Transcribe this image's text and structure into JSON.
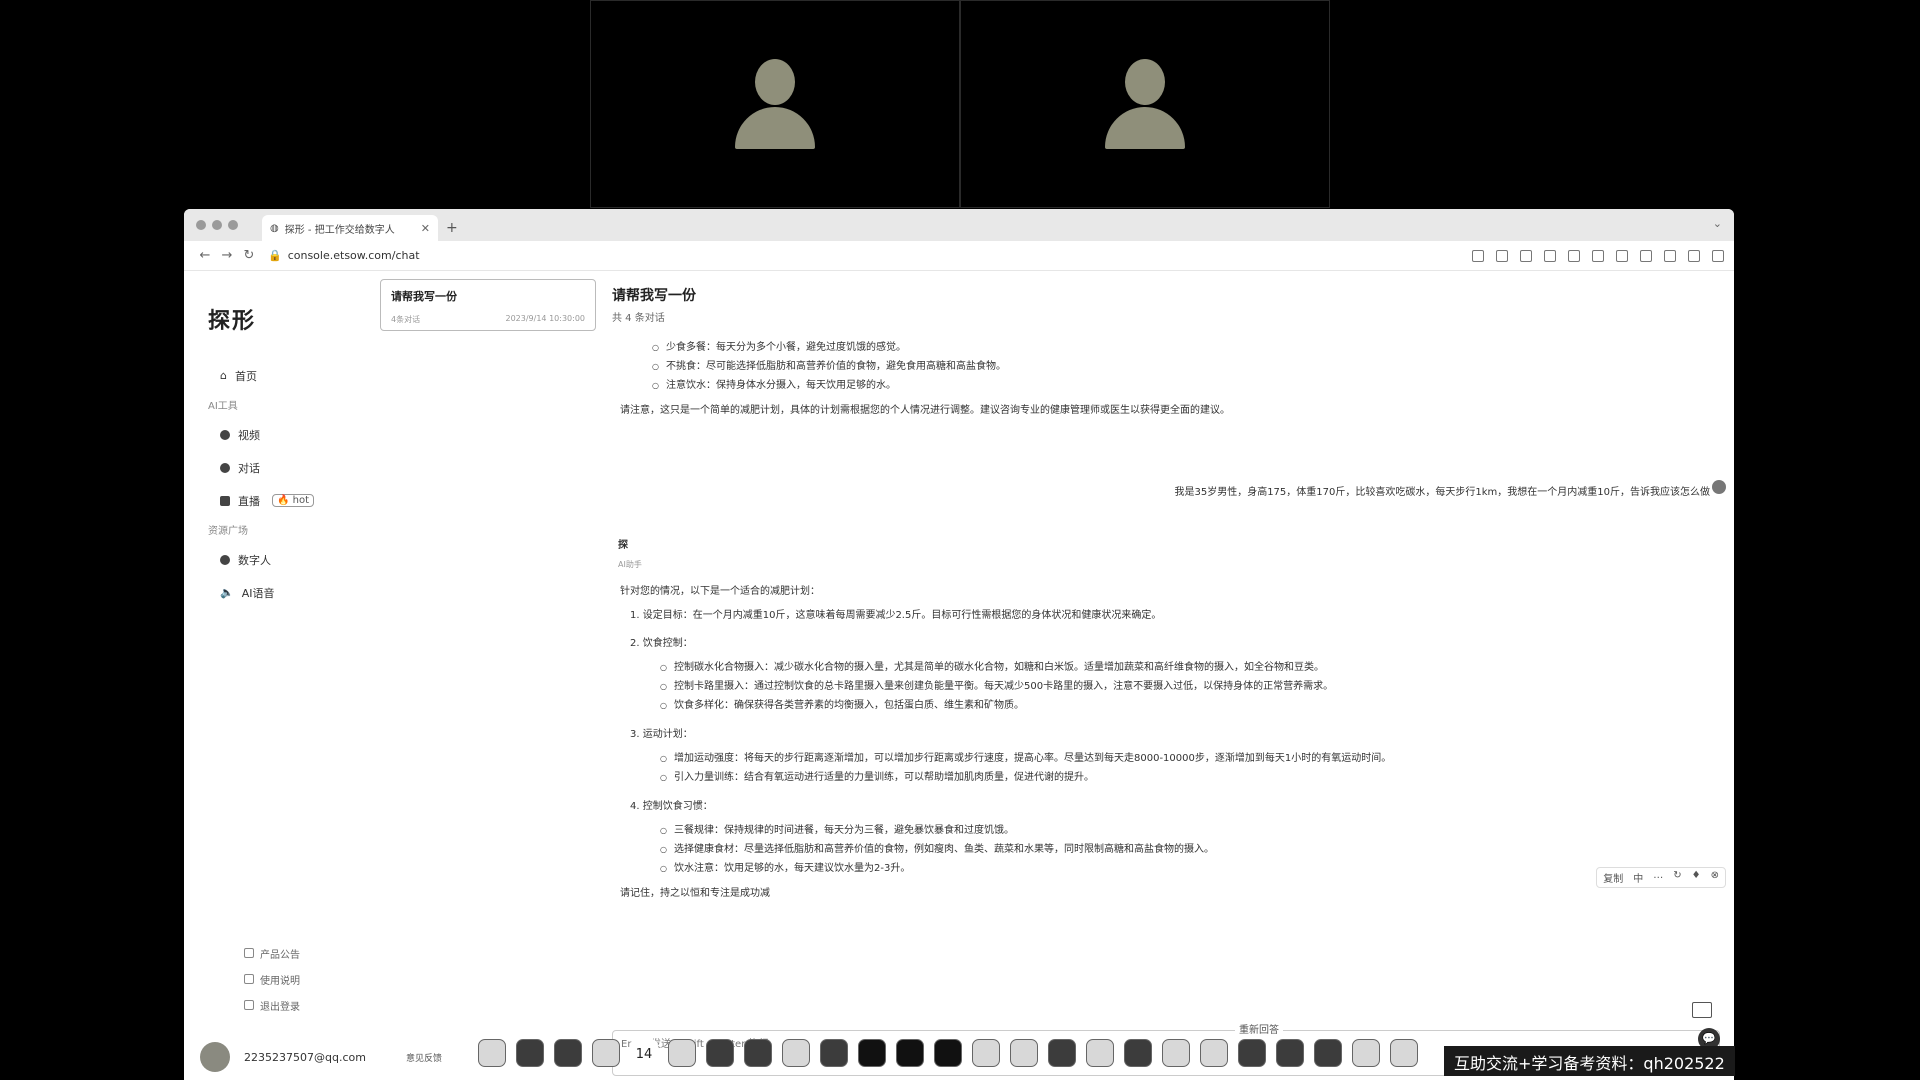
{
  "tab": {
    "title": "探形 - 把工作交给数字人"
  },
  "address": {
    "url": "console.etsow.com/chat"
  },
  "sidebar": {
    "logo": "探形",
    "home": "首页",
    "sections": [
      {
        "title": "AI工具",
        "items": [
          {
            "label": "视频",
            "badge": ""
          },
          {
            "label": "对话",
            "badge": ""
          },
          {
            "label": "直播",
            "badge": "🔥 hot"
          }
        ]
      },
      {
        "title": "资源广场",
        "items": [
          {
            "label": "数字人",
            "badge": ""
          },
          {
            "label": "AI语音",
            "badge": ""
          }
        ]
      }
    ],
    "footer": [
      "产品公告",
      "使用说明",
      "退出登录"
    ],
    "user_email": "2235237507@qq.com",
    "feedback": "意见反馈"
  },
  "conversations": [
    {
      "title": "请帮我写一份",
      "count": "4条对话",
      "time": "2023/9/14 10:30:00"
    }
  ],
  "chat": {
    "title": "请帮我写一份",
    "subtitle": "共 4 条对话",
    "prev_bullets": [
      "少食多餐：每天分为多个小餐，避免过度饥饿的感觉。",
      "不挑食：尽可能选择低脂肪和高营养价值的食物，避免食用高糖和高盐食物。",
      "注意饮水：保持身体水分摄入，每天饮用足够的水。"
    ],
    "prev_note": "请注意，这只是一个简单的减肥计划，具体的计划需根据您的个人情况进行调整。建议咨询专业的健康管理师或医生以获得更全面的建议。",
    "user_message": "我是35岁男性，身高175，体重170斤，比较喜欢吃碳水，每天步行1km，我想在一个月内减重10斤，告诉我应该怎么做",
    "bot_name": "探",
    "bot_role": "AI助手",
    "reply_intro": "针对您的情况，以下是一个适合的减肥计划：",
    "steps": [
      {
        "label": "1. 设定目标：在一个月内减重10斤，这意味着每周需要减少2.5斤。目标可行性需根据您的身体状况和健康状况来确定。",
        "bullets": []
      },
      {
        "label": "2. 饮食控制：",
        "bullets": [
          "控制碳水化合物摄入：减少碳水化合物的摄入量，尤其是简单的碳水化合物，如糖和白米饭。适量增加蔬菜和高纤维食物的摄入，如全谷物和豆类。",
          "控制卡路里摄入：通过控制饮食的总卡路里摄入量来创建负能量平衡。每天减少500卡路里的摄入，注意不要摄入过低，以保持身体的正常营养需求。",
          "饮食多样化：确保获得各类营养素的均衡摄入，包括蛋白质、维生素和矿物质。"
        ]
      },
      {
        "label": "3. 运动计划：",
        "bullets": [
          "增加运动强度：将每天的步行距离逐渐增加，可以增加步行距离或步行速度，提高心率。尽量达到每天走8000-10000步，逐渐增加到每天1小时的有氧运动时间。",
          "引入力量训练：结合有氧运动进行适量的力量训练，可以帮助增加肌肉质量，促进代谢的提升。"
        ]
      },
      {
        "label": "4. 控制饮食习惯：",
        "bullets": [
          "三餐规律：保持规律的时间进餐，每天分为三餐，避免暴饮暴食和过度饥饿。",
          "选择健康食材：尽量选择低脂肪和高营养价值的食物，例如瘦肉、鱼类、蔬菜和水果等，同时限制高糖和高盐食物的摄入。",
          "饮水注意：饮用足够的水，每天建议饮水量为2-3升。"
        ]
      }
    ],
    "reply_outro": "请记住，持之以恒和专注是成功减",
    "tools": [
      "复制",
      "中",
      "…",
      "↻",
      "♦",
      "⊗"
    ],
    "input_placeholder": "Enter 发送，Shift + Enter 换行",
    "tip": "重新回答",
    "send_icon": "💬"
  },
  "dock": {
    "calendar_day": "14"
  },
  "watermark": "互助交流+学习备考资料：qh202522"
}
